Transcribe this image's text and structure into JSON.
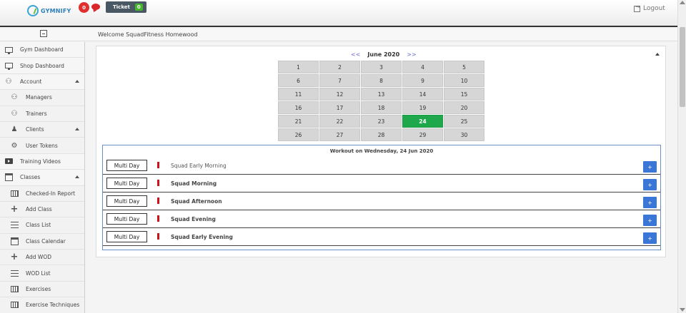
{
  "header": {
    "logo_text": "GYMNIFY",
    "notification_count": "0",
    "ticket_label": "Ticket",
    "ticket_count": "0",
    "logout_label": "Logout"
  },
  "subheader": {
    "welcome": "Welcome SquadFitness Homewood"
  },
  "sidebar": {
    "items": [
      {
        "label": "Gym Dashboard",
        "icon": "monitor-icon"
      },
      {
        "label": "Shop Dashboard",
        "icon": "monitor-icon"
      },
      {
        "label": "Account",
        "icon": "users-icon"
      },
      {
        "label": "Managers",
        "icon": "users-icon"
      },
      {
        "label": "Trainers",
        "icon": "users-icon"
      },
      {
        "label": "Clients",
        "icon": "user-add-icon"
      },
      {
        "label": "User Tokens",
        "icon": "gear-icon"
      },
      {
        "label": "Training Videos",
        "icon": "film-icon"
      },
      {
        "label": "Classes",
        "icon": "calendar-icon"
      },
      {
        "label": "Checked-In Report",
        "icon": "table-icon"
      },
      {
        "label": "Add Class",
        "icon": "plus-icon"
      },
      {
        "label": "Class List",
        "icon": "list-icon"
      },
      {
        "label": "Class Calendar",
        "icon": "calendar-icon"
      },
      {
        "label": "Add WOD",
        "icon": "plus-icon"
      },
      {
        "label": "WOD List",
        "icon": "list-icon"
      },
      {
        "label": "Exercises",
        "icon": "table-icon"
      },
      {
        "label": "Exercise Techniques",
        "icon": "table-icon"
      }
    ]
  },
  "calendar": {
    "prev": "<<",
    "next": ">>",
    "month_title": "June 2020",
    "days": [
      "1",
      "2",
      "3",
      "4",
      "5",
      "6",
      "7",
      "8",
      "9",
      "10",
      "11",
      "12",
      "13",
      "14",
      "15",
      "16",
      "17",
      "18",
      "19",
      "20",
      "21",
      "22",
      "23",
      "24",
      "25",
      "26",
      "27",
      "28",
      "29",
      "30"
    ],
    "selected_day": "24",
    "selected_color": "#1ea84b"
  },
  "workouts": {
    "title": "Workout on Wednesday, 24 Jun 2020",
    "add_label": "+",
    "rows": [
      {
        "type": "Multi Day",
        "name": "Squad Early Morning"
      },
      {
        "type": "Multi Day",
        "name": "Squad Morning"
      },
      {
        "type": "Multi Day",
        "name": "Squad Afternoon"
      },
      {
        "type": "Multi Day",
        "name": "Squad Evening"
      },
      {
        "type": "Multi Day",
        "name": "Squad Early Evening"
      }
    ]
  },
  "colors": {
    "accent_blue": "#3a75d8",
    "marker_red": "#d0111a"
  }
}
